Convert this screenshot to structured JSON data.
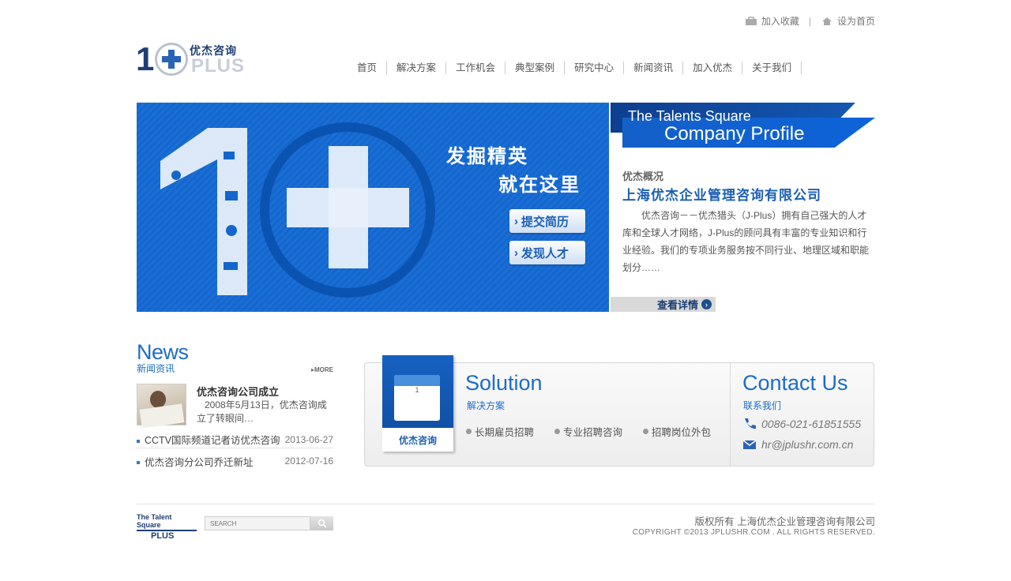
{
  "toplinks": {
    "bookmark": "加入收藏",
    "homepage": "设为首页"
  },
  "logo": {
    "cn": "优杰咨询",
    "en": "PLUS"
  },
  "nav": [
    "首页",
    "解决方案",
    "工作机会",
    "典型案例",
    "研究中心",
    "新闻资讯",
    "加入优杰",
    "关于我们"
  ],
  "banner": {
    "slogan1": "发掘精英",
    "slogan2": "就在这里",
    "btn_resume": "提交简历",
    "btn_talent": "发现人才"
  },
  "profile": {
    "title1": "The Talents Square",
    "title2": "Company Profile",
    "sub": "优杰概况",
    "company": "上海优杰企业管理咨询有限公司",
    "desc": "优杰咨询－－优杰猎头（J-Plus）拥有自己强大的人才库和全球人才网络，J-Plus的顾问具有丰富的专业知识和行业经验。我们的专项业务服务按不同行业、地理区域和职能划分……",
    "more": "查看详情"
  },
  "news": {
    "title_en": "News",
    "title_cn": "新闻资讯",
    "more": "MORE",
    "featured_title": "优杰咨询公司成立",
    "featured_text": "2008年5月13日，优杰咨询成立了转眼间…",
    "items": [
      {
        "title": "CCTV国际频道记者访优杰咨询",
        "date": "2013-06-27"
      },
      {
        "title": "优杰咨询分公司乔迁新址",
        "date": "2012-07-16"
      }
    ]
  },
  "solution": {
    "title_en": "Solution",
    "title_cn": "解决方案",
    "badge": "优杰咨询",
    "calendar_day": "1",
    "items": [
      "长期雇员招聘",
      "专业招聘咨询",
      "招聘岗位外包"
    ]
  },
  "contact": {
    "title_en": "Contact Us",
    "title_cn": "联系我们",
    "phone": "0086-021-61851555",
    "email": "hr@jplushr.com.cn"
  },
  "footer": {
    "logo_top": "The Talent Square",
    "logo_bottom": "PLUS",
    "search_placeholder": "SEARCH",
    "copyright_cn": "版权所有  上海优杰企业管理咨询有限公司",
    "copyright_en": "COPYRIGHT ©2013 JPLUSHR.COM . ALL RIGHTS RESERVED."
  },
  "colors": {
    "brand_blue": "#1d6cc8",
    "navy": "#1f3f73",
    "banner_blue": "#1466cc"
  }
}
